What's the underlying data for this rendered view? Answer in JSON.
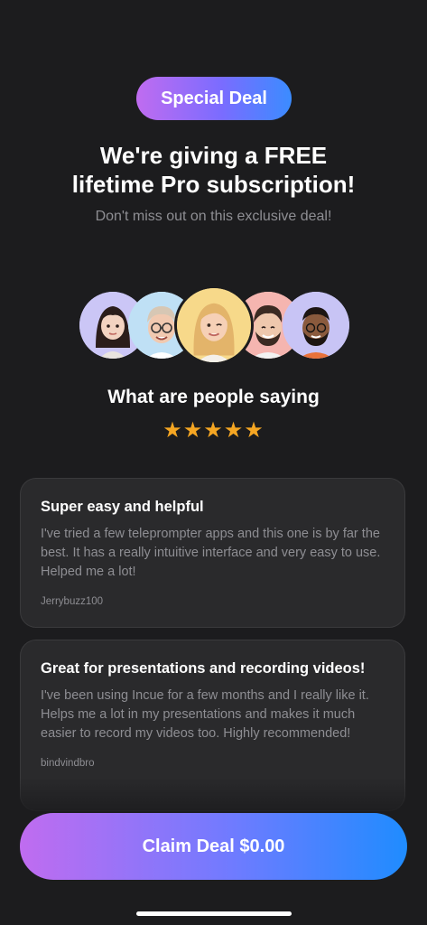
{
  "badge": {
    "label": "Special Deal"
  },
  "headline": {
    "line1": "We're giving a FREE",
    "line2": "lifetime Pro subscription!"
  },
  "subtitle": "Don't miss out on this exclusive deal!",
  "avatars": [
    {
      "name": "avatar-woman-dark-hair",
      "bg": "#c8c4f5"
    },
    {
      "name": "avatar-man-glasses",
      "bg": "#bfe0f5"
    },
    {
      "name": "avatar-woman-blonde-winking",
      "bg": "#f7d98a"
    },
    {
      "name": "avatar-man-beard",
      "bg": "#f5b5b0"
    },
    {
      "name": "avatar-man-dark-skin",
      "bg": "#c8c4f5"
    }
  ],
  "reviews_section": {
    "title": "What are people saying",
    "stars": "★★★★★",
    "rating": 5
  },
  "reviews": [
    {
      "title": "Super easy and helpful",
      "body": "I've tried a few teleprompter apps and this one is by far the best. It has a really intuitive interface and very easy to use. Helped me a lot!",
      "author": "Jerrybuzz100"
    },
    {
      "title": "Great for presentations and recording videos!",
      "body": "I've been using Incue for a few months and I really like it. Helps me a lot in my presentations and makes it much easier to record my videos too. Highly recommended!",
      "author": "bindvindbro"
    }
  ],
  "cta": {
    "label": "Claim Deal $0.00"
  },
  "colors": {
    "background": "#1c1c1e",
    "card": "#2a2a2c",
    "star": "#f5a623",
    "gradient_start": "#c06cf0",
    "gradient_end": "#1f8cff"
  }
}
